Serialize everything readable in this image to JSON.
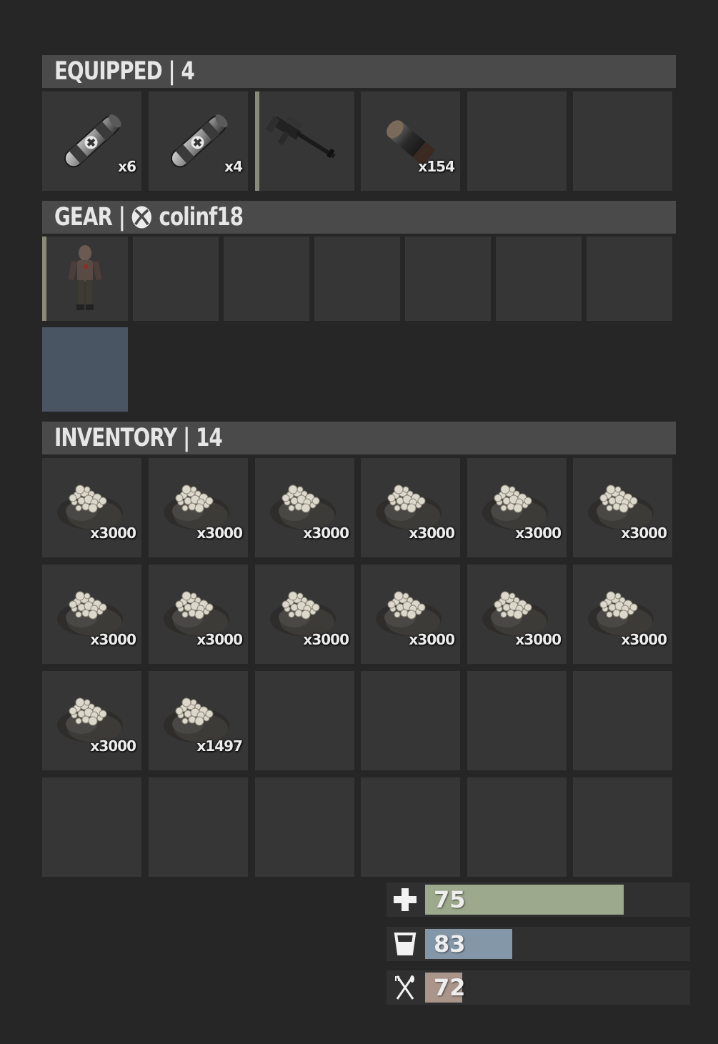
{
  "equipped": {
    "title": "EQUIPPED | 4",
    "slots": [
      {
        "icon": "medical-syringe-icon",
        "count": "x6"
      },
      {
        "icon": "medical-syringe-icon",
        "count": "x4"
      },
      {
        "icon": "rifle-icon",
        "count": ""
      },
      {
        "icon": "ammo-icon",
        "count": "x154"
      },
      {
        "icon": "",
        "count": ""
      },
      {
        "icon": "",
        "count": ""
      }
    ]
  },
  "gear": {
    "title_prefix": "GEAR |",
    "username": "colinf18",
    "platform_icon": "xbox-icon"
  },
  "inventory": {
    "title": "INVENTORY | 14",
    "counts": [
      "x3000",
      "x3000",
      "x3000",
      "x3000",
      "x3000",
      "x3000",
      "x3000",
      "x3000",
      "x3000",
      "x3000",
      "x3000",
      "x3000",
      "x3000",
      "x1497"
    ]
  },
  "vitals": {
    "health": {
      "value": "75",
      "fraction": 0.75,
      "color": "#9ca98c",
      "icon": "health-cross-icon"
    },
    "water": {
      "value": "83",
      "fraction": 0.33,
      "color": "#8497a8",
      "icon": "water-cup-icon"
    },
    "food": {
      "value": "72",
      "fraction": 0.14,
      "color": "#a9958a",
      "icon": "fork-knife-icon"
    }
  }
}
